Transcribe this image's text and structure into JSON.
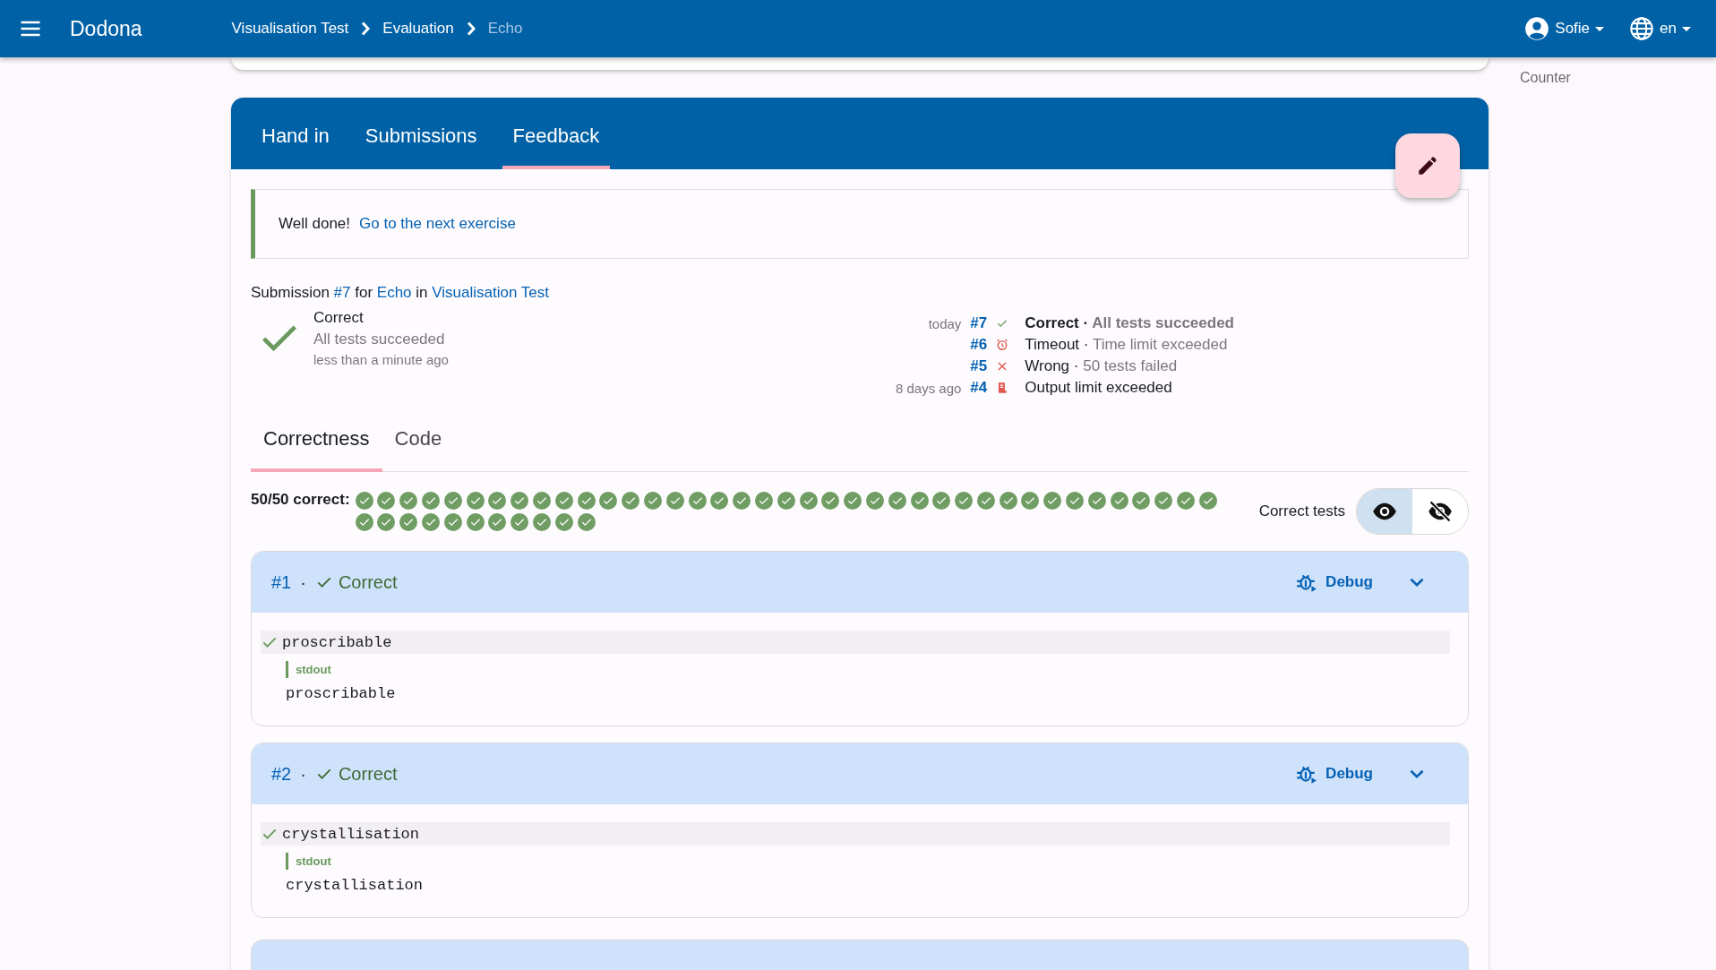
{
  "header": {
    "app_name": "Dodona",
    "breadcrumbs": [
      {
        "label": "Visualisation Test",
        "current": false
      },
      {
        "label": "Evaluation",
        "current": false
      },
      {
        "label": "Echo",
        "current": true
      }
    ],
    "user": "Sofie",
    "language": "en"
  },
  "sidebar": {
    "items": [
      {
        "label": "Counter",
        "selected": false
      }
    ]
  },
  "tabs": [
    {
      "label": "Hand in",
      "selected": false
    },
    {
      "label": "Submissions",
      "selected": false
    },
    {
      "label": "Feedback",
      "selected": true
    }
  ],
  "alert": {
    "text": "Well done!",
    "link": "Go to the next exercise"
  },
  "submission_line": [
    {
      "text": "Submission ",
      "link": false
    },
    {
      "text": "#7",
      "link": true
    },
    {
      "text": " for ",
      "link": false
    },
    {
      "text": "Echo",
      "link": true
    },
    {
      "text": " in ",
      "link": false
    },
    {
      "text": "Visualisation Test",
      "link": true
    }
  ],
  "status": {
    "kind": "correct",
    "title": "Correct",
    "summary": "All tests succeeded",
    "time": "less than a minute ago"
  },
  "history": [
    {
      "date": "today",
      "number": "#7",
      "kind": "correct",
      "status": "Correct",
      "separator": "·",
      "detail": "All tests succeeded",
      "selected": true
    },
    {
      "number": "#6",
      "kind": "timeout",
      "status": "Timeout",
      "separator": "·",
      "detail": "Time limit exceeded",
      "selected": false
    },
    {
      "number": "#5",
      "kind": "wrong",
      "status": "Wrong",
      "separator": "·",
      "detail": "50 tests failed",
      "selected": false
    },
    {
      "date": "8 days ago",
      "number": "#4",
      "kind": "output-limit",
      "status": "Output limit exceeded",
      "selected": false
    }
  ],
  "result_tabs": [
    {
      "label": "Correctness",
      "selected": true
    },
    {
      "label": "Code",
      "selected": false
    }
  ],
  "summary": {
    "label": "50/50 correct:",
    "tests": [
      true,
      true,
      true,
      true,
      true,
      true,
      true,
      true,
      true,
      true,
      true,
      true,
      true,
      true,
      true,
      true,
      true,
      true,
      true,
      true,
      true,
      true,
      true,
      true,
      true,
      true,
      true,
      true,
      true,
      true,
      true,
      true,
      true,
      true,
      true,
      true,
      true,
      true,
      true,
      true,
      true,
      true,
      true,
      true,
      true,
      true,
      true,
      true,
      true,
      true
    ]
  },
  "correct_tests_toggle": {
    "label": "Correct tests",
    "options": [
      {
        "kind": "show",
        "selected": true
      },
      {
        "kind": "hide",
        "selected": false
      }
    ]
  },
  "tests": [
    {
      "number": "#1",
      "separator": "·",
      "correct": true,
      "status": "Correct",
      "debug": "Debug",
      "input": "proscribable",
      "channel": "stdout",
      "output": "proscribable"
    },
    {
      "number": "#2",
      "separator": "·",
      "correct": true,
      "status": "Correct",
      "debug": "Debug",
      "input": "crystallisation",
      "channel": "stdout",
      "output": "crystallisation"
    }
  ]
}
